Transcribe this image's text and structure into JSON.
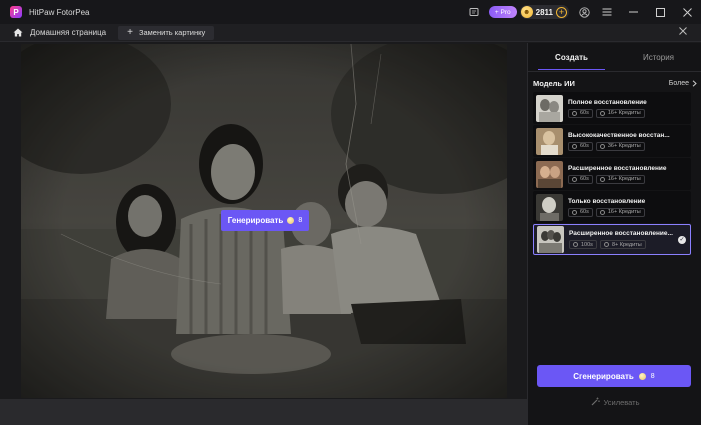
{
  "app": {
    "title": "HitPaw FotorPea",
    "logo_letter": "P"
  },
  "titlebar": {
    "pro_label": "+ Pro",
    "credits_value": "2811",
    "icons": [
      "feedback-icon",
      "pro-badge",
      "coin-icon",
      "add-credits-icon",
      "account-icon",
      "menu-icon",
      "minimize-icon",
      "maximize-icon",
      "close-icon"
    ]
  },
  "navbar": {
    "home_label": "Домашняя страница",
    "replace_label": "Заменить картинку",
    "replace_plus": "+"
  },
  "canvas": {
    "overlay_generate_label": "Генерировать",
    "overlay_generate_cost": "8"
  },
  "panel": {
    "tabs": [
      {
        "label": "Создать",
        "active": true
      },
      {
        "label": "История",
        "active": false
      }
    ],
    "model_label": "Модель ИИ",
    "more_label": "Более",
    "models": [
      {
        "title": "Полное восстановление",
        "time": "60s",
        "credits": "16+ Кредиты",
        "selected": false
      },
      {
        "title": "Высококачественное восстан...",
        "time": "60s",
        "credits": "36+ Кредиты",
        "selected": false
      },
      {
        "title": "Расширенное восстановление",
        "time": "60s",
        "credits": "16+ Кредиты",
        "selected": false
      },
      {
        "title": "Только восстановление",
        "time": "60s",
        "credits": "16+ Кредиты",
        "selected": false
      },
      {
        "title": "Расширенное восстановление...",
        "time": "100s",
        "credits": "8+ Кредиты",
        "selected": true
      }
    ],
    "generate_label": "Сгенерировать",
    "generate_cost": "8",
    "enhance_label": "Усилевать"
  },
  "colors": {
    "accent": "#6b57f5",
    "selected_border": "#8b80ff",
    "coin": "#f2b632"
  }
}
